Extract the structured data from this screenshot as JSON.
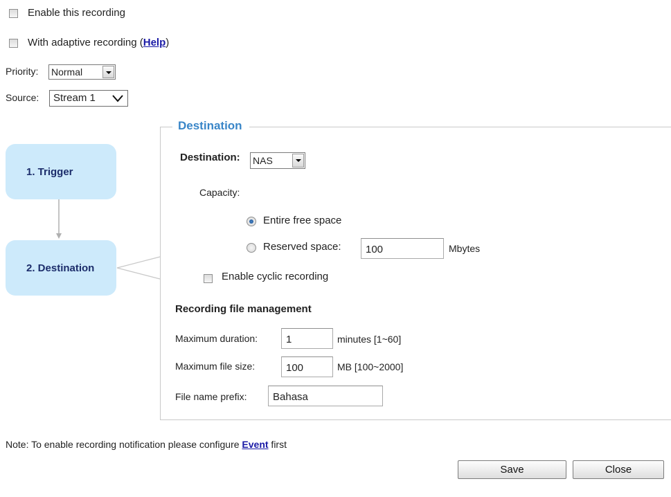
{
  "top": {
    "enable_recording_label": "Enable this recording",
    "adaptive_label": "With adaptive recording (",
    "adaptive_help_link": "Help",
    "adaptive_label_end": ")",
    "priority_label": "Priority:",
    "priority_value": "Normal",
    "source_label": "Source:",
    "source_value": "Stream 1"
  },
  "steps": [
    {
      "label": "1.  Trigger"
    },
    {
      "label": "2.  Destination"
    }
  ],
  "destination": {
    "legend": "Destination",
    "destination_label": "Destination:",
    "destination_value": "NAS",
    "capacity_label": "Capacity:",
    "entire_free_space_label": "Entire free space",
    "reserved_space_label": "Reserved space:",
    "reserved_space_value": "100",
    "reserved_space_unit": "Mbytes",
    "cyclic_label": "Enable cyclic recording",
    "file_mgmt_heading": "Recording file management",
    "max_duration_label": "Maximum duration:",
    "max_duration_value": "1",
    "max_duration_unit": "minutes [1~60]",
    "max_file_size_label": "Maximum file size:",
    "max_file_size_value": "100",
    "max_file_size_unit": "MB [100~2000]",
    "prefix_label": "File name prefix:",
    "prefix_value": "Bahasa"
  },
  "footer": {
    "note_text": "Note: To enable recording notification please configure ",
    "note_link": "Event",
    "note_end": " first",
    "save_label": "Save",
    "close_label": "Close"
  },
  "icons": {
    "dropdown": "dropdown-arrow-icon",
    "chevron": "chevron-down-icon"
  }
}
